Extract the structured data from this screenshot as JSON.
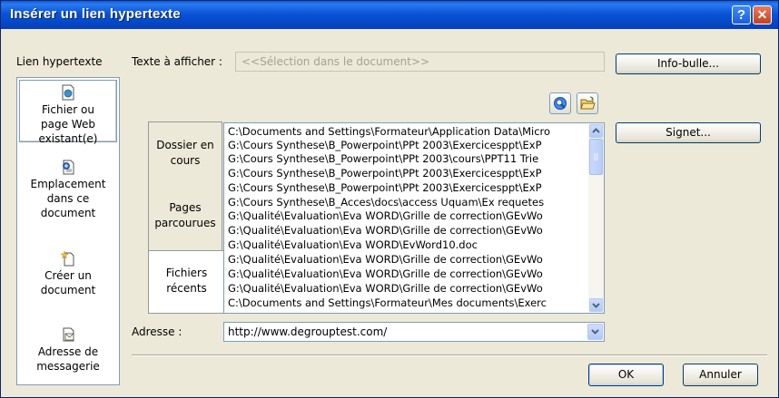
{
  "window": {
    "title": "Insérer un lien hypertexte",
    "help_glyph": "?",
    "close_glyph": "✕"
  },
  "link_to_label": "Lien hypertexte",
  "text_to_display": {
    "label": "Texte à afficher :",
    "value": "<<Sélection dans le document>>"
  },
  "buttons": {
    "screentip": "Info-bulle...",
    "bookmark": "Signet...",
    "ok": "OK",
    "cancel": "Annuler"
  },
  "link_bar": [
    {
      "label_lines": [
        "Fichier ou",
        "page Web",
        "existant(e)"
      ],
      "icon": "web-page-icon",
      "selected": true
    },
    {
      "label_lines": [
        "Emplacement",
        "dans ce",
        "document"
      ],
      "icon": "place-in-document-icon",
      "selected": false
    },
    {
      "label_lines": [
        "Créer un",
        "document"
      ],
      "icon": "new-document-icon",
      "selected": false
    },
    {
      "label_lines": [
        "Adresse de",
        "messagerie"
      ],
      "icon": "email-address-icon",
      "selected": false
    }
  ],
  "look_in_tabs": [
    {
      "label_lines": [
        "Dossier en",
        "cours"
      ],
      "selected": false
    },
    {
      "label_lines": [
        "Pages",
        "parcourues"
      ],
      "selected": false
    },
    {
      "label_lines": [
        "Fichiers",
        "récents"
      ],
      "selected": true
    }
  ],
  "recent_files": [
    "C:\\Documents and Settings\\Formateur\\Application Data\\Micro",
    "G:\\Cours Synthese\\B_Powerpoint\\PPt 2003\\Exercicesppt\\ExP",
    "G:\\Cours Synthese\\B_Powerpoint\\PPt 2003\\cours\\PPT11 Trie",
    "G:\\Cours Synthese\\B_Powerpoint\\PPt 2003\\Exercicesppt\\ExP",
    "G:\\Cours Synthese\\B_Powerpoint\\PPt 2003\\Exercicesppt\\ExP",
    "G:\\Cours Synthese\\B_Acces\\docs\\access Uquam\\Ex requetes",
    "G:\\Qualité\\Evaluation\\Eva WORD\\Grille de correction\\GEvWo",
    "G:\\Qualité\\Evaluation\\Eva WORD\\Grille de correction\\GEvWo",
    "G:\\Qualité\\Evaluation\\Eva WORD\\EvWord10.doc",
    "G:\\Qualité\\Evaluation\\Eva WORD\\Grille de correction\\GEvWo",
    "G:\\Qualité\\Evaluation\\Eva WORD\\Grille de correction\\GEvWo",
    "G:\\Qualité\\Evaluation\\Eva WORD\\Grille de correction\\GEvWo",
    "C:\\Documents and Settings\\Formateur\\Mes documents\\Exerc"
  ],
  "address": {
    "label": "Adresse :",
    "value": "http://www.degrouptest.com/"
  },
  "toolbar_icons": [
    "browse-web-icon",
    "browse-file-icon"
  ],
  "colors": {
    "title_bar": "#0a54d6",
    "dialog_bg": "#ece9d8",
    "border_blue": "#7f9db9"
  }
}
